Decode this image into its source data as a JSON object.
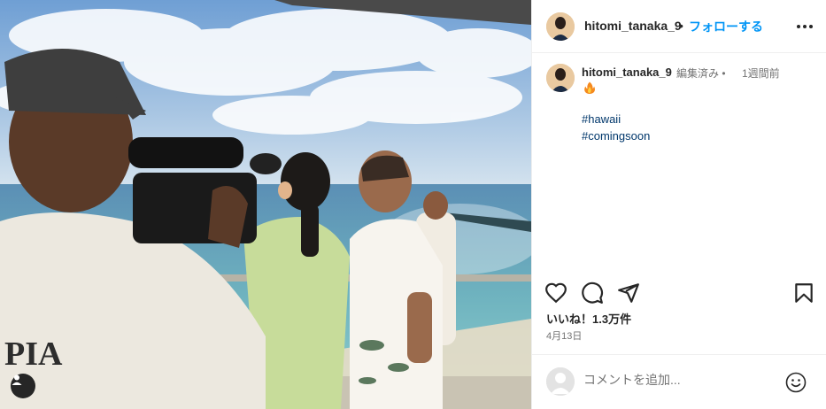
{
  "post": {
    "username": "hitomi_tanaka_9",
    "dot": "•",
    "follow_label": "フォローする",
    "more_icon": "more-horizontal-icon"
  },
  "caption": {
    "username": "hitomi_tanaka_9",
    "edited": "編集済み •",
    "time": "1週間前",
    "emoji": "fire-emoji",
    "hashtags": [
      "#hawaii",
      "#comingsoon"
    ]
  },
  "actions": {
    "like_icon": "heart-icon",
    "comment_icon": "comment-icon",
    "share_icon": "send-icon",
    "save_icon": "bookmark-icon"
  },
  "likes": "いいね！1.3万件",
  "date": "4月13日",
  "comment": {
    "placeholder": "コメントを追加...",
    "emoji_icon": "smile-icon"
  },
  "photo": {
    "shirt_text": "PIA",
    "tag_icon": "user-tag-icon"
  },
  "colors": {
    "accent": "#0095f6",
    "hashtag": "#00376b",
    "text": "#262626",
    "muted": "#737373"
  }
}
